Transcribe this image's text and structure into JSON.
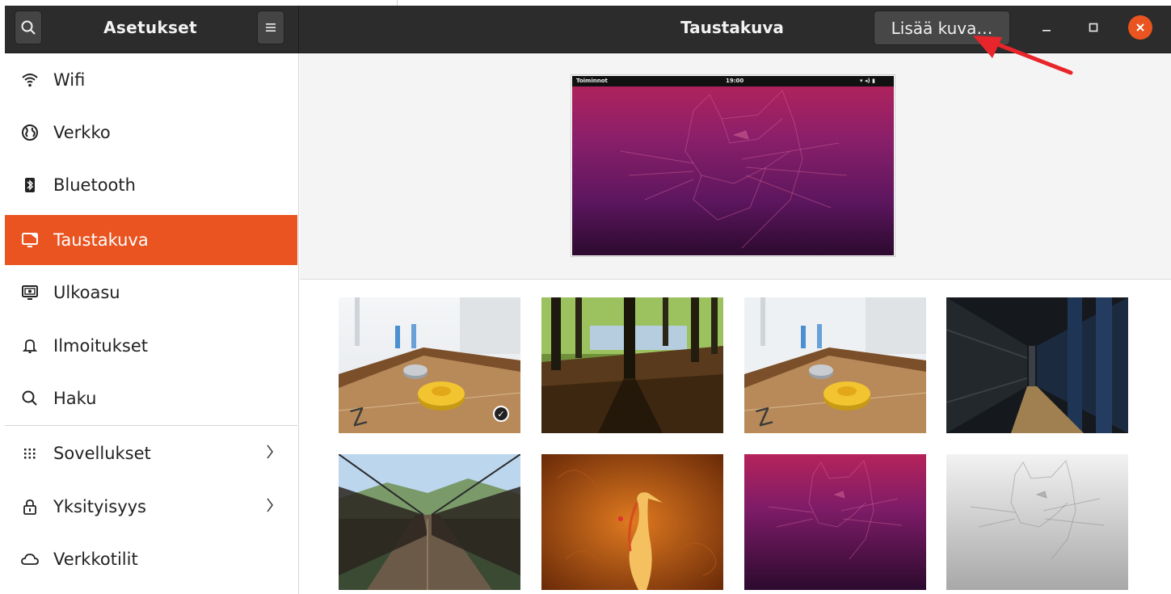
{
  "header": {
    "app_title": "Asetukset",
    "page_title": "Taustakuva",
    "add_image_label": "Lisää kuva…"
  },
  "sidebar": {
    "items": [
      {
        "label": "Wifi",
        "icon": "wifi-icon"
      },
      {
        "label": "Verkko",
        "icon": "globe-icon"
      },
      {
        "label": "Bluetooth",
        "icon": "bluetooth-icon"
      },
      {
        "label": "Taustakuva",
        "icon": "monitor-icon",
        "active": true
      },
      {
        "label": "Ulkoasu",
        "icon": "appearance-icon"
      },
      {
        "label": "Ilmoitukset",
        "icon": "bell-icon"
      },
      {
        "label": "Haku",
        "icon": "search-icon"
      },
      {
        "label": "Sovellukset",
        "icon": "apps-grid-icon",
        "chevron": true
      },
      {
        "label": "Yksityisyys",
        "icon": "lock-icon",
        "chevron": true
      },
      {
        "label": "Verkkotilit",
        "icon": "cloud-icon"
      }
    ]
  },
  "preview": {
    "topbar_left": "Toiminnot",
    "topbar_time": "19:00"
  },
  "wallpapers": [
    {
      "name": "table-with-pucks",
      "selected": true
    },
    {
      "name": "forest-trees"
    },
    {
      "name": "table-with-pucks-2"
    },
    {
      "name": "subway-station"
    },
    {
      "name": "suspension-bridge"
    },
    {
      "name": "orange-bird"
    },
    {
      "name": "purple-cat"
    },
    {
      "name": "grey-cat"
    }
  ],
  "colors": {
    "accent": "#e95420",
    "header_bg": "#2c2c2c",
    "annotation_arrow": "#e8252b"
  }
}
